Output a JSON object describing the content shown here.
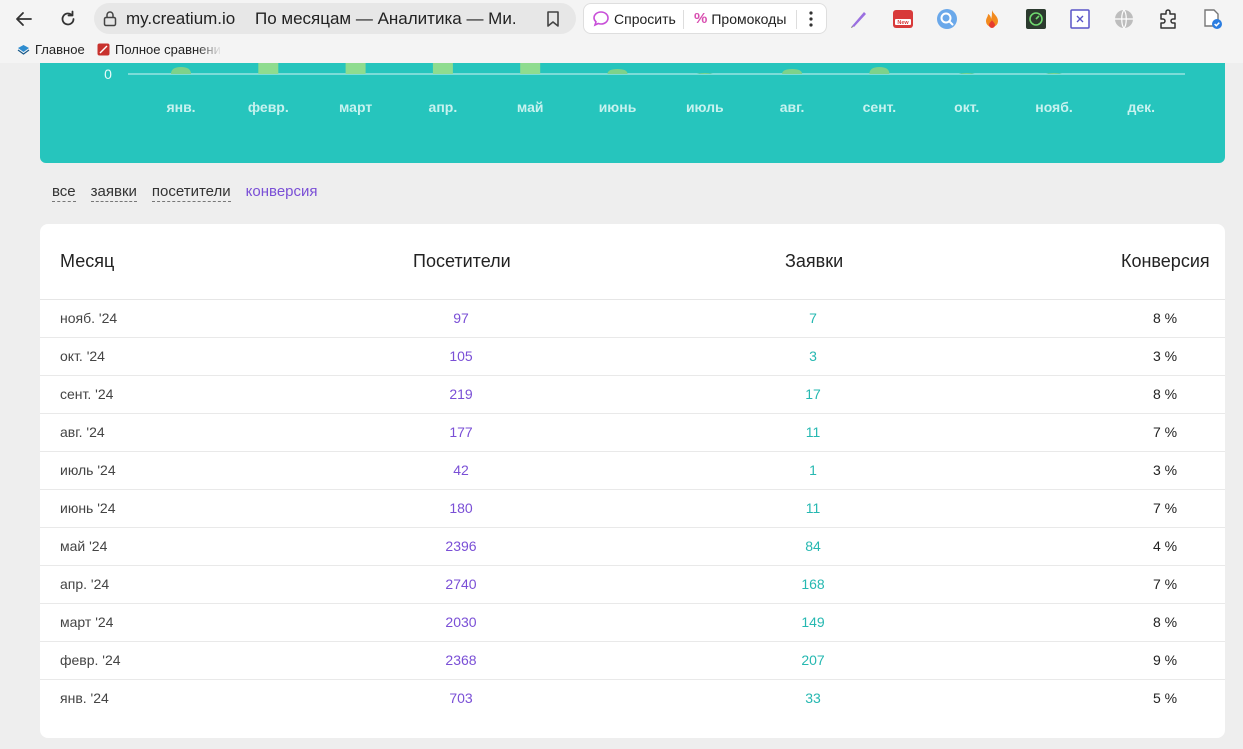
{
  "browser": {
    "url_domain": "my.creatium.io",
    "page_title": "По месяцам — Аналитика — Ми...",
    "ask_label": "Спросить",
    "promo_label": "Промокоды",
    "bookmarks": [
      {
        "label": "Главное",
        "icon": "home-bookmark-icon"
      },
      {
        "label": "Полное сравнени",
        "icon": "compare-bookmark-icon"
      }
    ],
    "extensions": [
      "pen-extension-icon",
      "new-badge-extension-icon",
      "search-extension-icon",
      "fire-extension-icon",
      "speed-extension-icon",
      "close-box-extension-icon",
      "globe-extension-icon",
      "puzzle-extension-icon",
      "doc-check-extension-icon"
    ]
  },
  "chart_data": {
    "type": "bar",
    "categories": [
      "янв.",
      "февр.",
      "март",
      "апр.",
      "май",
      "июнь",
      "июль",
      "авг.",
      "сент.",
      "окт.",
      "нояб.",
      "дек."
    ],
    "y_tick_visible": "0",
    "series": [
      {
        "values": [
          703,
          2368,
          2030,
          2740,
          2396,
          180,
          42,
          177,
          219,
          105,
          97,
          0
        ]
      }
    ],
    "colors": {
      "bar_tall": "#8fdc8f",
      "bar_low": "#7ed28a",
      "axis": "#ffffff",
      "background": "#26c5bd"
    }
  },
  "filters": [
    {
      "label": "все",
      "active": false
    },
    {
      "label": "заявки",
      "active": false
    },
    {
      "label": "посетители",
      "active": false
    },
    {
      "label": "конверсия",
      "active": true
    }
  ],
  "table": {
    "headers": {
      "month": "Месяц",
      "visitors": "Посетители",
      "requests": "Заявки",
      "conversion": "Конверсия"
    },
    "rows": [
      {
        "month": "нояб. '24",
        "visitors": "97",
        "requests": "7",
        "conversion": "8 %"
      },
      {
        "month": "окт. '24",
        "visitors": "105",
        "requests": "3",
        "conversion": "3 %"
      },
      {
        "month": "сент. '24",
        "visitors": "219",
        "requests": "17",
        "conversion": "8 %"
      },
      {
        "month": "авг. '24",
        "visitors": "177",
        "requests": "11",
        "conversion": "7 %"
      },
      {
        "month": "июль '24",
        "visitors": "42",
        "requests": "1",
        "conversion": "3 %"
      },
      {
        "month": "июнь '24",
        "visitors": "180",
        "requests": "11",
        "conversion": "7 %"
      },
      {
        "month": "май '24",
        "visitors": "2396",
        "requests": "84",
        "conversion": "4 %"
      },
      {
        "month": "апр. '24",
        "visitors": "2740",
        "requests": "168",
        "conversion": "7 %"
      },
      {
        "month": "март '24",
        "visitors": "2030",
        "requests": "149",
        "conversion": "8 %"
      },
      {
        "month": "февр. '24",
        "visitors": "2368",
        "requests": "207",
        "conversion": "9 %"
      },
      {
        "month": "янв. '24",
        "visitors": "703",
        "requests": "33",
        "conversion": "5 %"
      }
    ]
  },
  "colors": {
    "accent_purple": "#7a4fd6",
    "accent_teal": "#26b8b1",
    "panel_teal": "#26c5bd"
  }
}
